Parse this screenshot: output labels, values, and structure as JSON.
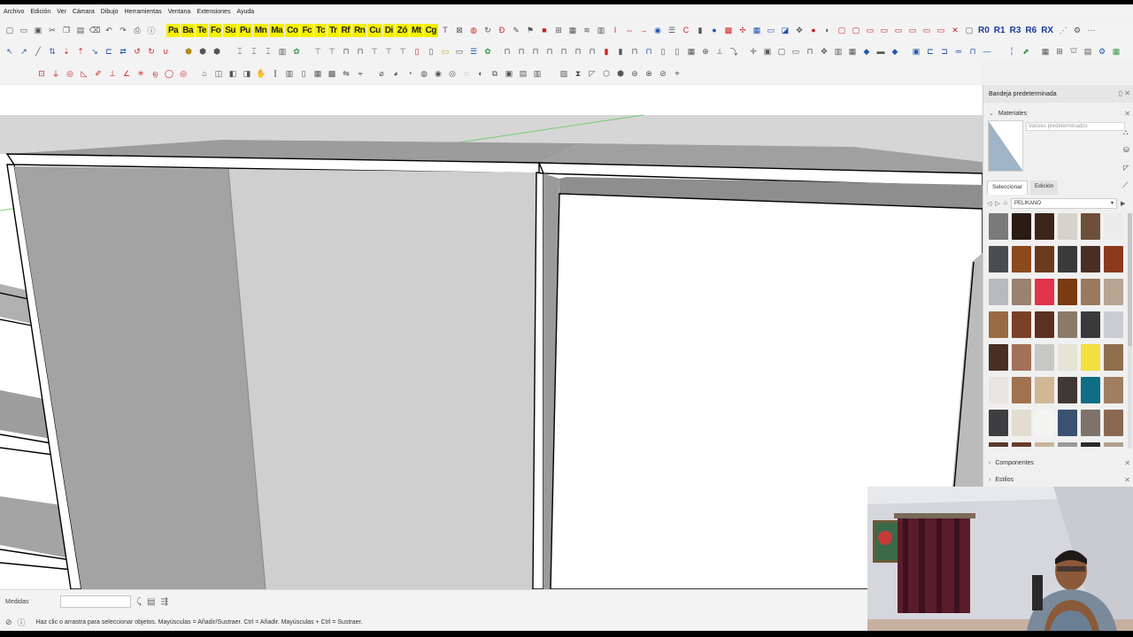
{
  "menu": [
    "Archivo",
    "Edición",
    "Ver",
    "Cámara",
    "Dibujo",
    "Herramientas",
    "Ventana",
    "Extensiones",
    "Ayuda"
  ],
  "toolbar_yellow": [
    "Pa",
    "Ba",
    "Te",
    "Fo",
    "Su",
    "Pu",
    "Mn",
    "Ma",
    "Co",
    "Fc",
    "Tc",
    "Tr",
    "Rf",
    "Rn",
    "Cu",
    "Di",
    "Zó",
    "Mt",
    "Cg"
  ],
  "toolbar_right_labels": [
    "R0",
    "R1",
    "R3",
    "R6",
    "RX"
  ],
  "tray": {
    "title": "Bandeja predeterminada",
    "materials_label": "Materiales",
    "material_name_placeholder": "Valores predeterminados",
    "tab_select": "Seleccionar",
    "tab_edit": "Edición",
    "library": "PELIKANO",
    "components_label": "Componentes",
    "styles_label": "Estilos",
    "swatch_colors": [
      "#7a7a7a",
      "#2a1c14",
      "#3b2419",
      "#d6d2cc",
      "#6e4f3a",
      "#ececec",
      "#4a4d4f",
      "#8a4a1e",
      "#6b3a1c",
      "#3a3a3a",
      "#4a2e24",
      "#8c3a1e",
      "#b8babc",
      "#9a8270",
      "#e2344a",
      "#7a3a12",
      "#9a7a5e",
      "#b7a592",
      "#9a6a42",
      "#7a4026",
      "#5c3020",
      "#8a7a6a",
      "#3a3a3c",
      "#c9ccd2",
      "#4a3024",
      "#a3705a",
      "#c7c7c5",
      "#e6e4d6",
      "#f2e040",
      "#8f6e4e",
      "#e8e6df",
      "#a07250",
      "#d0b896",
      "#403834",
      "#0f6e86",
      "#a07e62",
      "#3e3e40",
      "#e2ddd0",
      "#f4f4f2",
      "#3a5270",
      "#7d736b",
      "#8a6850",
      "#5a3a2a",
      "#6a3a28",
      "#c8b49a",
      "#9a9a9a",
      "#2a2a2a",
      "#b0a090"
    ]
  },
  "measures": {
    "label": "Medidas",
    "value": ""
  },
  "status": {
    "hint": "Haz clic o arrastra para seleccionar objetos. Mayúsculas = Añadir/Sustraer. Ctrl = Añadir. Mayúsculas + Ctrl = Sustraer."
  }
}
